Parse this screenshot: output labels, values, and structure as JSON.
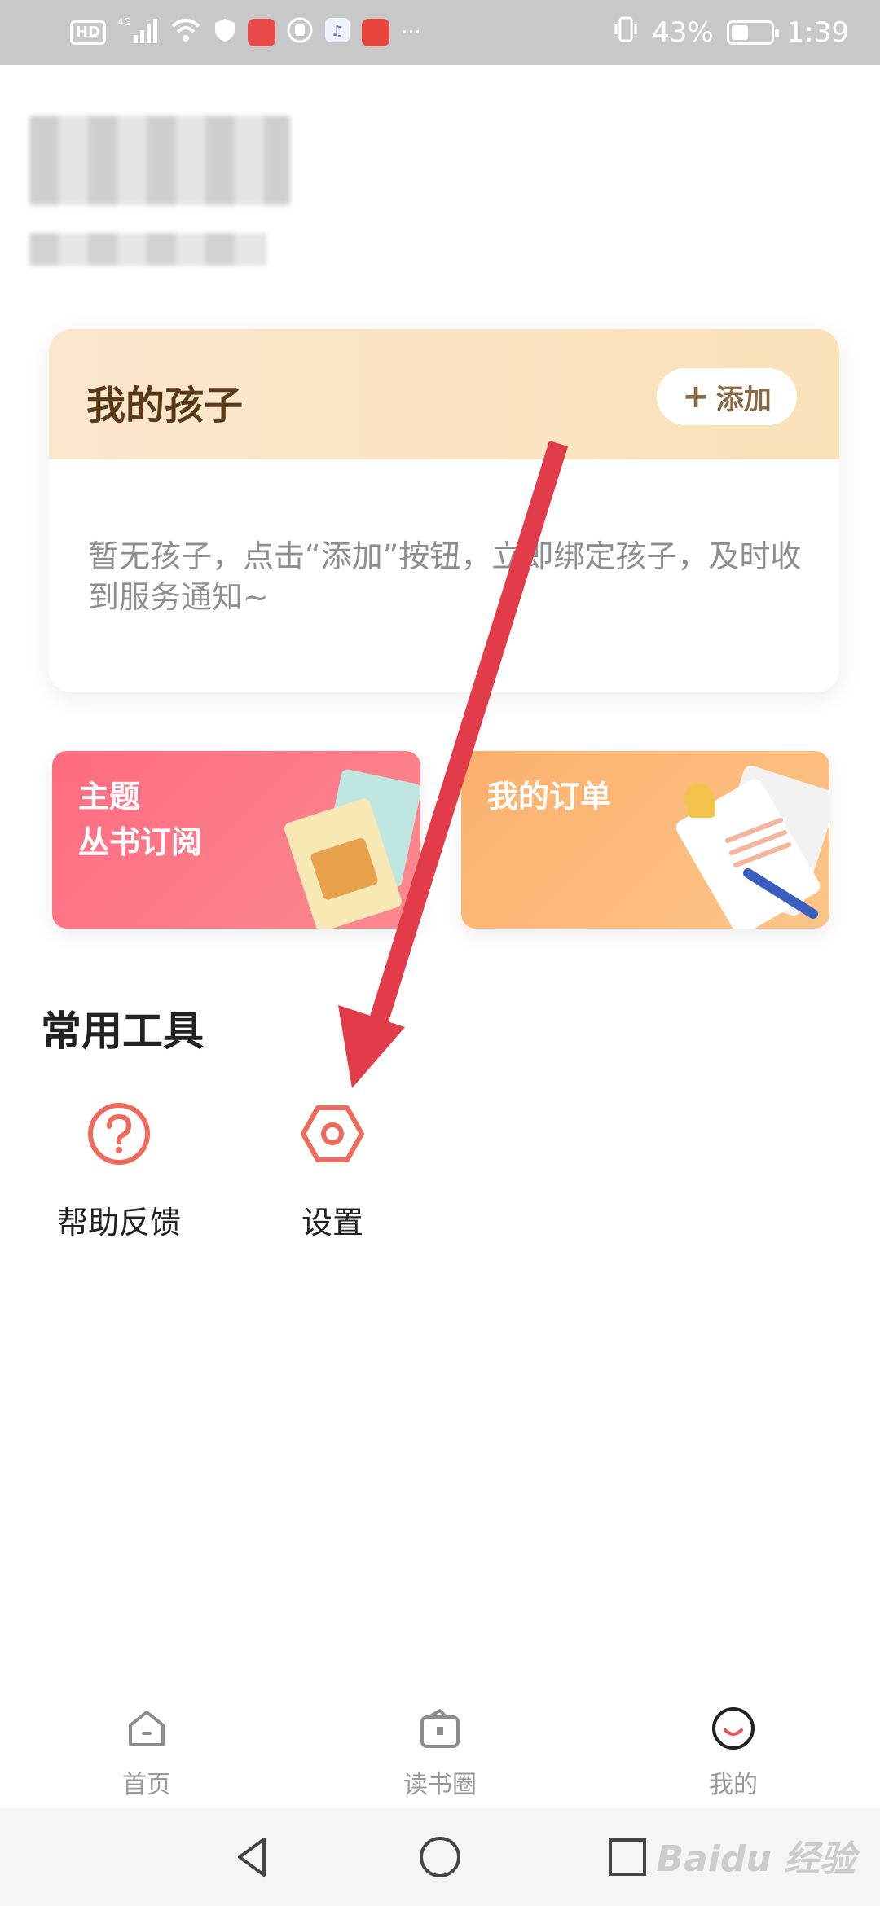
{
  "status_bar": {
    "hd": "HD",
    "network": "4G",
    "more": "···",
    "battery_percent": "43%",
    "battery_level": 0.43,
    "time": "1:39"
  },
  "children_card": {
    "title": "我的孩子",
    "add_label": "添加",
    "empty_text": "暂无孩子，点击“添加”按钮，立即绑定孩子，及时收到服务通知~"
  },
  "tiles": {
    "theme_line1": "主题",
    "theme_line2": "丛书订阅",
    "orders": "我的订单"
  },
  "tools": {
    "title": "常用工具",
    "help_label": "帮助反馈",
    "settings_label": "设置"
  },
  "bottom_nav": {
    "home": "首页",
    "reading_circle": "读书圈",
    "mine": "我的"
  },
  "watermark": "Baidu 经验",
  "colors": {
    "accent_red": "#e8505b",
    "tool_icon": "#ef6a5a",
    "card_header": "#f9e1b8",
    "theme_tile": "#ff6b82",
    "order_tile": "#fbb06d"
  },
  "icons": {
    "help": "question-circle-icon",
    "settings": "hexagon-gear-icon",
    "home": "house-icon",
    "reading": "book-box-icon",
    "mine": "smile-face-icon"
  }
}
